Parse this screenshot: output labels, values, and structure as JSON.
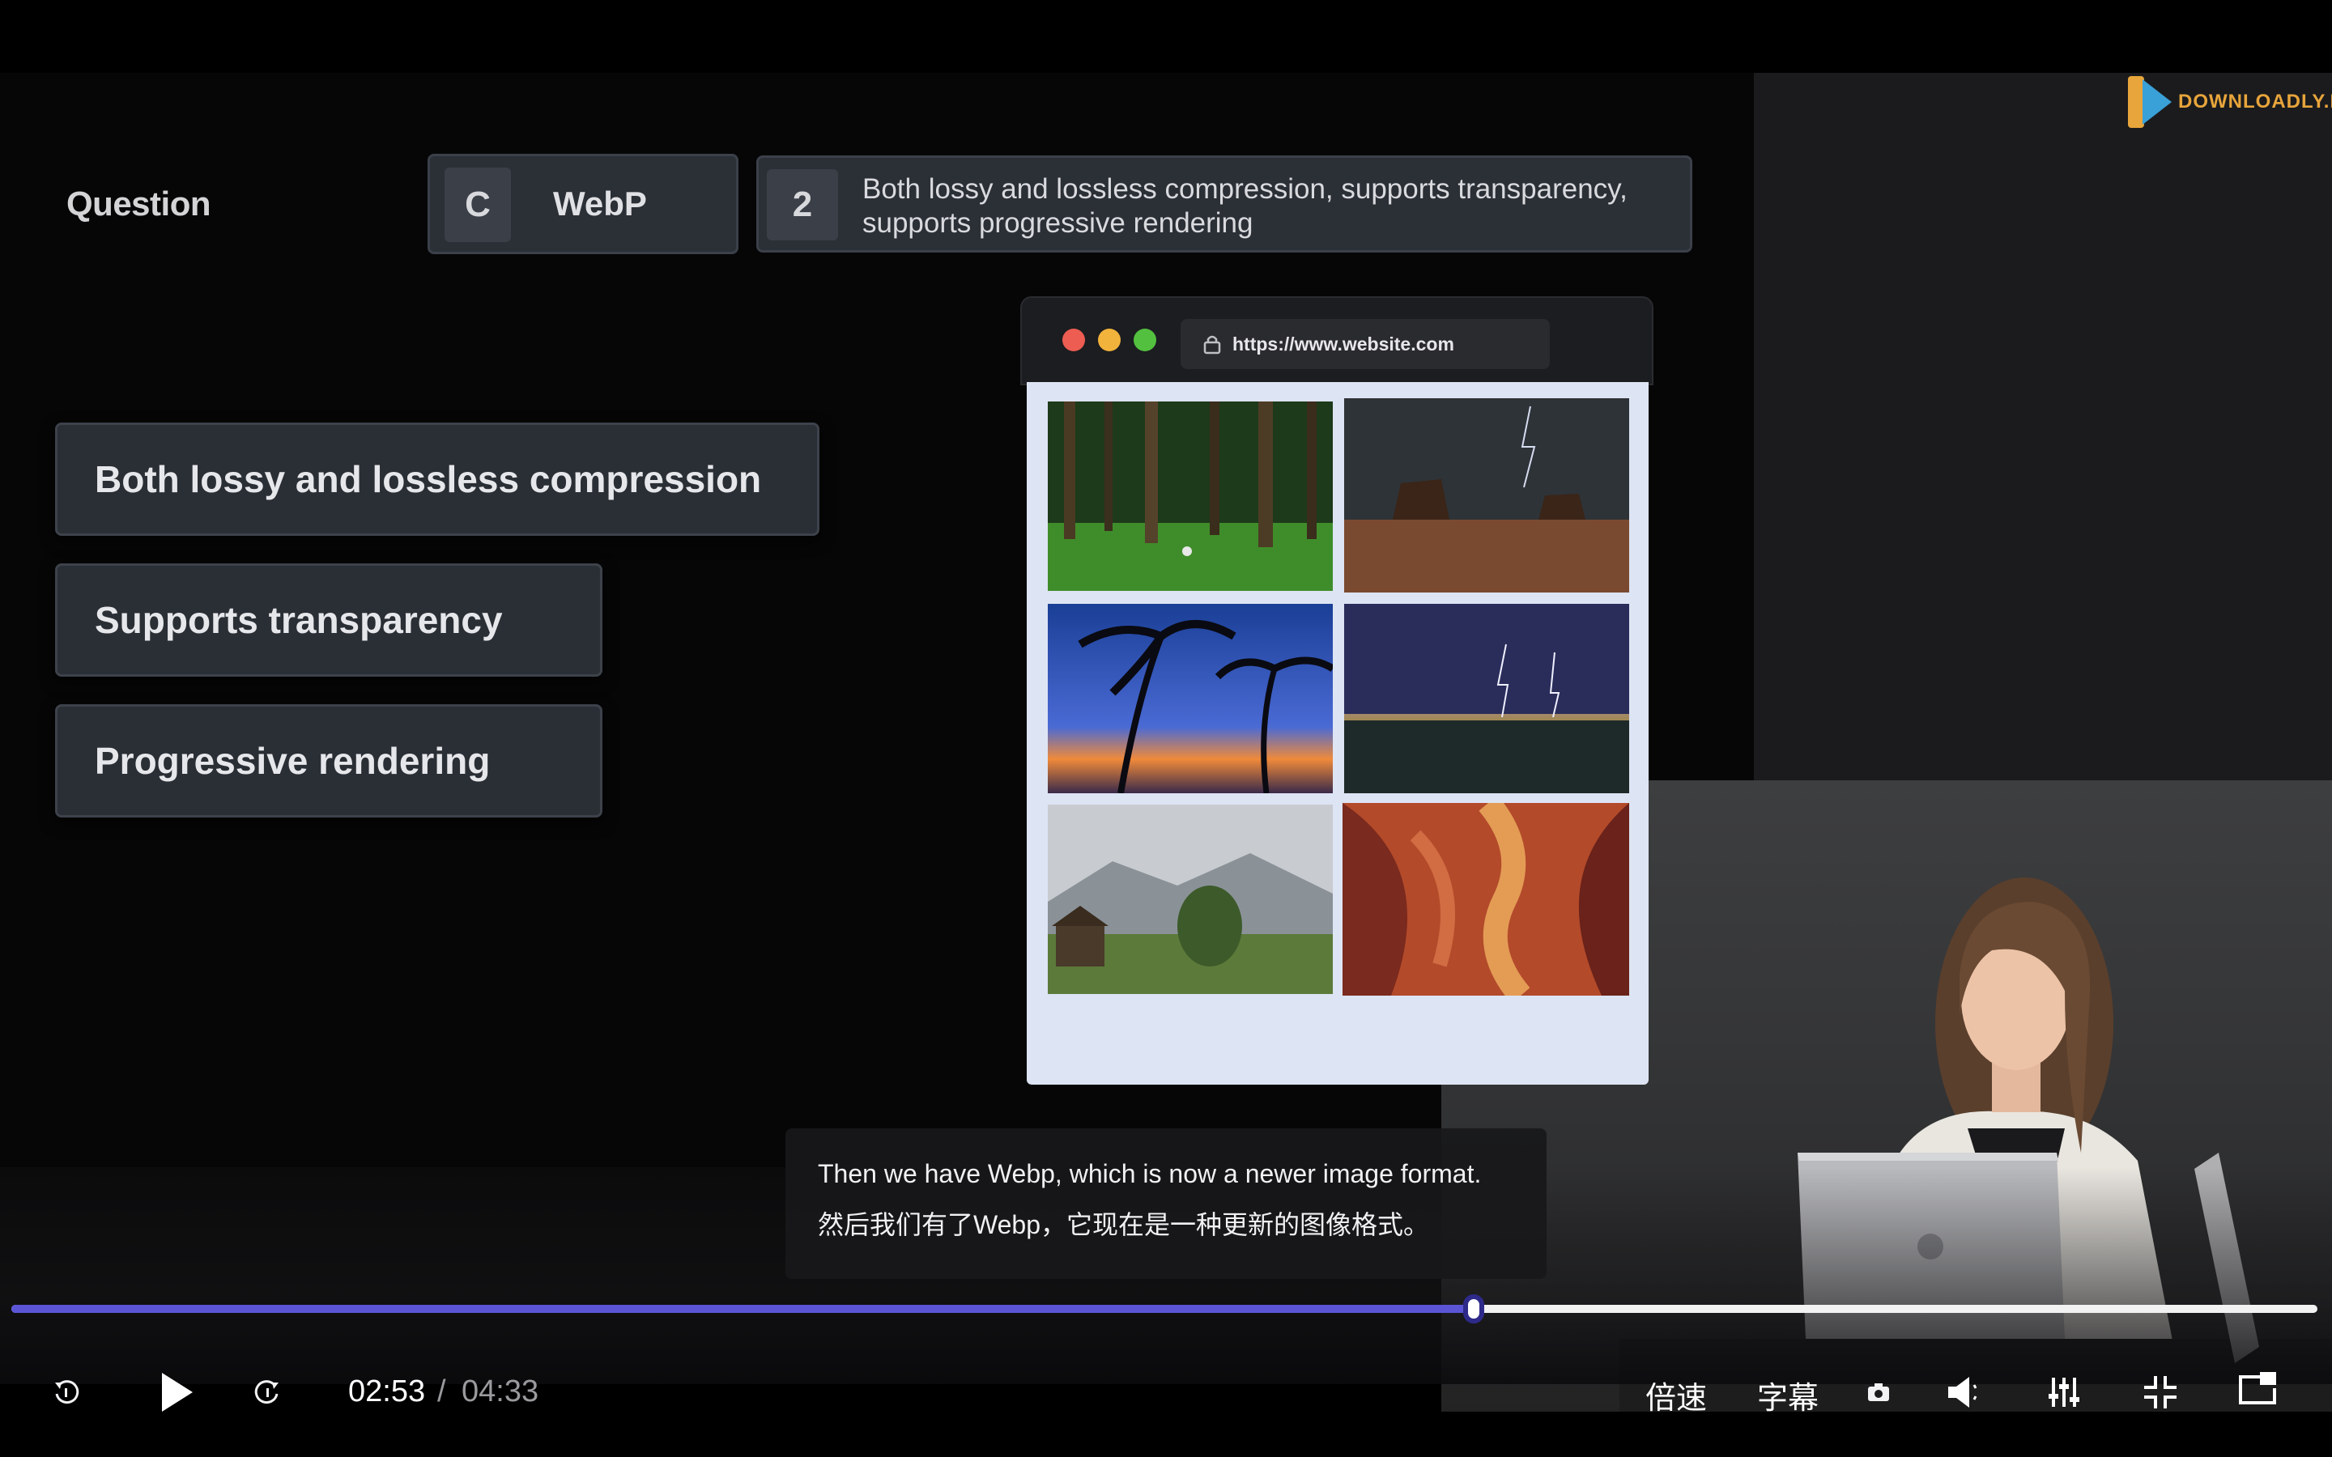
{
  "slide": {
    "question_label": "Question",
    "option": {
      "letter": "C",
      "name": "WebP"
    },
    "answer": {
      "number": "2",
      "text_line1": "Both lossy and lossless compression, supports transparency,",
      "text_line2": "supports progressive rendering"
    },
    "features": [
      "Both lossy and lossless compression",
      "Supports transparency",
      "Progressive rendering"
    ]
  },
  "browser": {
    "url": "https://www.website.com",
    "photos": [
      "forest",
      "desert-lightning",
      "palm-sunset",
      "lightning-city",
      "alpine-village",
      "red-canyon"
    ]
  },
  "watermark": {
    "text": "DOWNLOADLY.IR"
  },
  "captions": {
    "en": "Then we have Webp, which is now a newer image format.",
    "zh": "然后我们有了Webp，它现在是一种更新的图像格式。"
  },
  "player": {
    "current_time": "02:53",
    "separator": "/",
    "total_time": "04:33",
    "progress": 0.634,
    "speed_label": "倍速",
    "subtitle_label": "字幕",
    "icons": [
      "rewind-icon",
      "play-icon",
      "forward-icon",
      "screenshot-icon",
      "volume-icon",
      "equalizer-icon",
      "exit-fullscreen-icon",
      "picture-in-picture-icon"
    ],
    "accent_color": "#5b55d6"
  }
}
